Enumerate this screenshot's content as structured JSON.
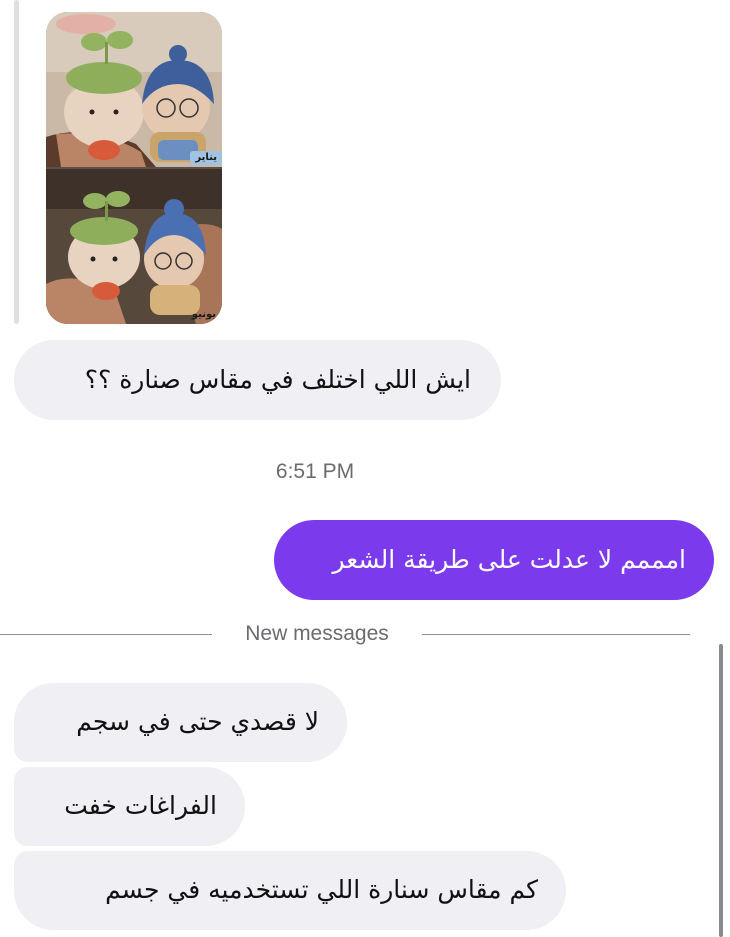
{
  "chat": {
    "shared_image": {
      "top_caption": "يناير",
      "bottom_caption": "يونيو"
    },
    "messages": [
      {
        "direction": "incoming",
        "text": "ايش اللي اختلف في مقاس صنارة ؟؟"
      },
      {
        "direction": "outgoing",
        "text": "امممم لا عدلت على طريقة الشعر"
      },
      {
        "direction": "incoming",
        "text": "لا قصدي حتى في سجم"
      },
      {
        "direction": "incoming",
        "text": "الفراغات خفت"
      },
      {
        "direction": "incoming",
        "text": "كم مقاس سنارة اللي تستخدميه في جسم"
      }
    ],
    "timestamp": "6:51 PM",
    "new_messages_label": "New messages"
  },
  "colors": {
    "outgoing_bubble": "#7c3aed",
    "incoming_bubble": "#efeff4",
    "meta_text": "#6b6b6f"
  },
  "icons": {
    "photo_subject": "crochet-amigurumi-dolls-photo"
  }
}
